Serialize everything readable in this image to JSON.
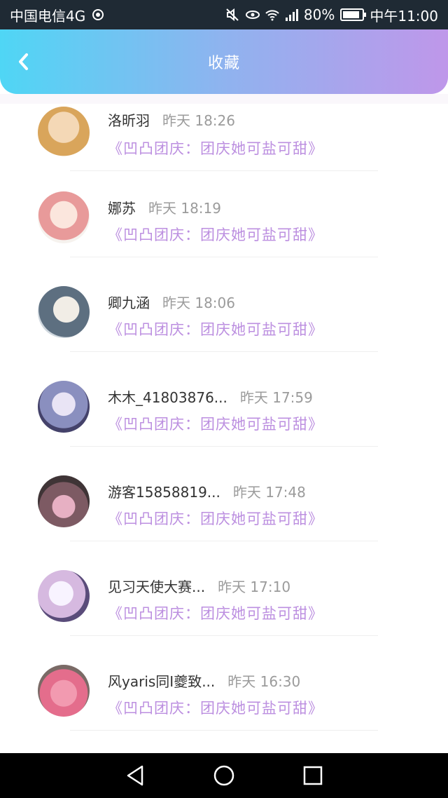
{
  "status": {
    "carrier": "中国电信4G",
    "battery": "80%",
    "time": "中午11:00",
    "battery_level": 0.8
  },
  "header": {
    "title": "收藏",
    "accent_from": "#4fd6f5",
    "accent_to": "#bf97ea"
  },
  "items": [
    {
      "name": "洛昕羽",
      "time": "昨天 18:26",
      "link": "《凹凸团庆：团庆她可盐可甜》",
      "avatar_color": "#d9a55b"
    },
    {
      "name": "娜苏",
      "time": "昨天 18:19",
      "link": "《凹凸团庆：团庆她可盐可甜》",
      "avatar_color": "#e89a9a"
    },
    {
      "name": "卿九涵",
      "time": "昨天 18:06",
      "link": "《凹凸团庆：团庆她可盐可甜》",
      "avatar_color": "#5d6f80"
    },
    {
      "name": "木木_41803876...",
      "time": "昨天 17:59",
      "link": "《凹凸团庆：团庆她可盐可甜》",
      "avatar_color": "#8a8fbf"
    },
    {
      "name": "游客15858819...",
      "time": "昨天 17:48",
      "link": "《凹凸团庆：团庆她可盐可甜》",
      "avatar_color": "#7d5a63"
    },
    {
      "name": "见习天使大赛...",
      "time": "昨天 17:10",
      "link": "《凹凸团庆：团庆她可盐可甜》",
      "avatar_color": "#d6b9e0"
    },
    {
      "name": "风yaris同I夔致...",
      "time": "昨天 16:30",
      "link": "《凹凸团庆：团庆她可盐可甜》",
      "avatar_color": "#e46d8c"
    }
  ],
  "icons": {
    "back": "chevron-left-icon",
    "nav_back": "triangle-back-icon",
    "nav_home": "circle-home-icon",
    "nav_recent": "square-recent-icon"
  }
}
